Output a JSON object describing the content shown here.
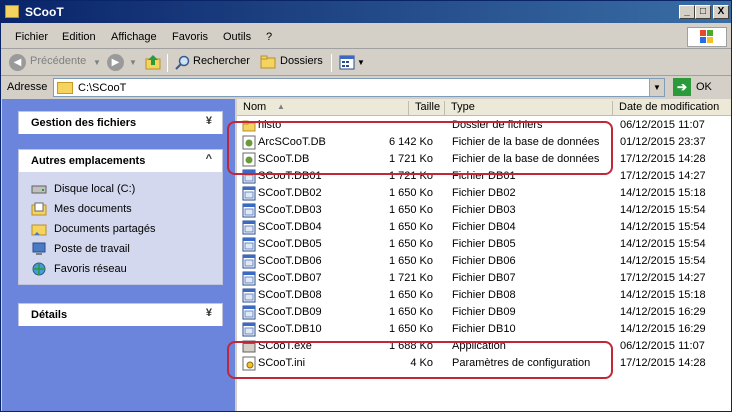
{
  "window": {
    "title": "SCooT",
    "buttons": {
      "min": "_",
      "max": "□",
      "close": "X"
    }
  },
  "menu": [
    "Fichier",
    "Edition",
    "Affichage",
    "Favoris",
    "Outils",
    "?"
  ],
  "toolbar": {
    "back": "Précédente",
    "search": "Rechercher",
    "folders": "Dossiers"
  },
  "address": {
    "label": "Adresse",
    "path": "C:\\SCooT",
    "go": "OK"
  },
  "panels": {
    "tasks": {
      "title": "Gestion des fichiers",
      "chev": "¥"
    },
    "places": {
      "title": "Autres emplacements",
      "chev": "^",
      "items": [
        "Disque local (C:)",
        "Mes documents",
        "Documents partagés",
        "Poste de travail",
        "Favoris réseau"
      ]
    },
    "details": {
      "title": "Détails",
      "chev": "¥"
    }
  },
  "columns": {
    "name": "Nom",
    "size": "Taille",
    "type": "Type",
    "date": "Date de modification"
  },
  "files": [
    {
      "icon": "folder-icon",
      "name": "histo",
      "size": "",
      "type": "Dossier de fichiers",
      "date": "06/12/2015 11:07"
    },
    {
      "icon": "db-file-icon",
      "name": "ArcSCooT.DB",
      "size": "6 142 Ko",
      "type": "Fichier de la base de données",
      "date": "01/12/2015 23:37"
    },
    {
      "icon": "db-file-icon",
      "name": "SCooT.DB",
      "size": "1 721 Ko",
      "type": "Fichier de la base de données",
      "date": "17/12/2015 14:28"
    },
    {
      "icon": "file-icon",
      "name": "SCooT.DB01",
      "size": "1 721 Ko",
      "type": "Fichier DB01",
      "date": "17/12/2015 14:27"
    },
    {
      "icon": "file-icon",
      "name": "SCooT.DB02",
      "size": "1 650 Ko",
      "type": "Fichier DB02",
      "date": "14/12/2015 15:18"
    },
    {
      "icon": "file-icon",
      "name": "SCooT.DB03",
      "size": "1 650 Ko",
      "type": "Fichier DB03",
      "date": "14/12/2015 15:54"
    },
    {
      "icon": "file-icon",
      "name": "SCooT.DB04",
      "size": "1 650 Ko",
      "type": "Fichier DB04",
      "date": "14/12/2015 15:54"
    },
    {
      "icon": "file-icon",
      "name": "SCooT.DB05",
      "size": "1 650 Ko",
      "type": "Fichier DB05",
      "date": "14/12/2015 15:54"
    },
    {
      "icon": "file-icon",
      "name": "SCooT.DB06",
      "size": "1 650 Ko",
      "type": "Fichier DB06",
      "date": "14/12/2015 15:54"
    },
    {
      "icon": "file-icon",
      "name": "SCooT.DB07",
      "size": "1 721 Ko",
      "type": "Fichier DB07",
      "date": "17/12/2015 14:27"
    },
    {
      "icon": "file-icon",
      "name": "SCooT.DB08",
      "size": "1 650 Ko",
      "type": "Fichier DB08",
      "date": "14/12/2015 15:18"
    },
    {
      "icon": "file-icon",
      "name": "SCooT.DB09",
      "size": "1 650 Ko",
      "type": "Fichier DB09",
      "date": "14/12/2015 16:29"
    },
    {
      "icon": "file-icon",
      "name": "SCooT.DB10",
      "size": "1 650 Ko",
      "type": "Fichier DB10",
      "date": "14/12/2015 16:29"
    },
    {
      "icon": "exe-icon",
      "name": "SCooT.exe",
      "size": "1 688 Ko",
      "type": "Application",
      "date": "06/12/2015 11:07"
    },
    {
      "icon": "ini-file-icon",
      "name": "SCooT.ini",
      "size": "4 Ko",
      "type": "Paramètres de configuration",
      "date": "17/12/2015 14:28"
    }
  ],
  "colors": {
    "highlight": "#c0283a",
    "title_bar": "#0a246a",
    "task_pane": "#6b85dc"
  }
}
